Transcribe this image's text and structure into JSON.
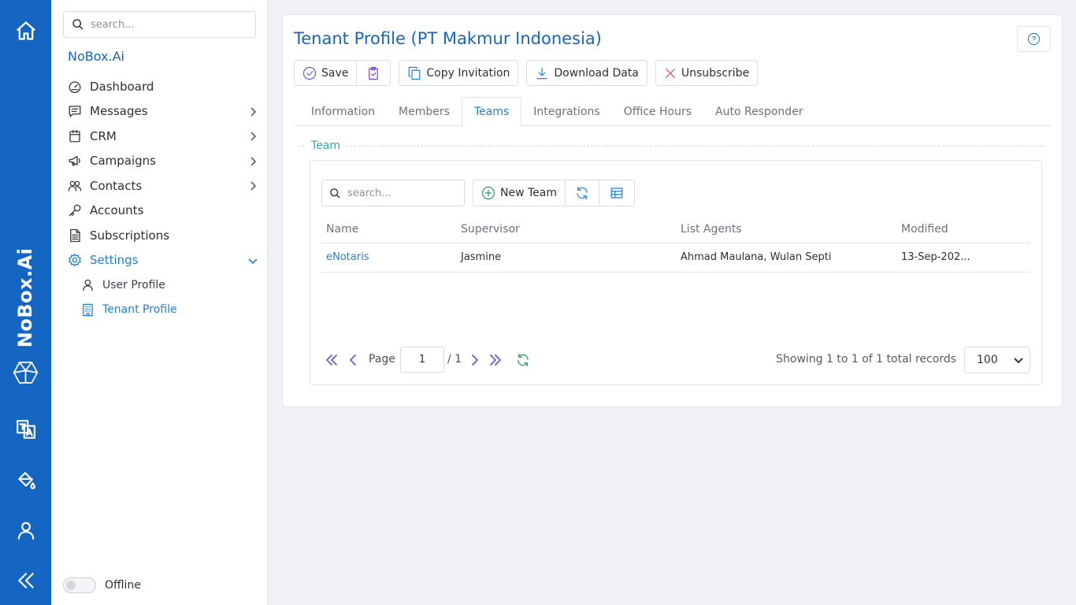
{
  "rail": {
    "brand": "NoBox.Ai",
    "icons": [
      "home-icon",
      "logo-cube-icon",
      "translate-icon",
      "paint-bucket-icon",
      "user-icon",
      "collapse-icon"
    ]
  },
  "sidebar": {
    "search_placeholder": "search...",
    "brand": "NoBox.Ai",
    "items": [
      {
        "label": "Dashboard",
        "icon": "gauge-icon"
      },
      {
        "label": "Messages",
        "icon": "message-icon"
      },
      {
        "label": "CRM",
        "icon": "calendar-icon"
      },
      {
        "label": "Campaigns",
        "icon": "megaphone-icon"
      },
      {
        "label": "Contacts",
        "icon": "users-icon"
      },
      {
        "label": "Accounts",
        "icon": "key-icon"
      },
      {
        "label": "Subscriptions",
        "icon": "document-icon"
      },
      {
        "label": "Settings",
        "icon": "gear-icon"
      }
    ],
    "sub_items": [
      {
        "label": "User Profile",
        "icon": "user-icon"
      },
      {
        "label": "Tenant Profile",
        "icon": "building-icon"
      }
    ],
    "offline_label": "Offline"
  },
  "page": {
    "title": "Tenant Profile (PT Makmur Indonesia)"
  },
  "toolbar": {
    "save": "Save",
    "copy_invitation": "Copy Invitation",
    "download_data": "Download Data",
    "unsubscribe": "Unsubscribe"
  },
  "tabs": [
    "Information",
    "Members",
    "Teams",
    "Integrations",
    "Office Hours",
    "Auto Responder"
  ],
  "active_tab": "Teams",
  "section": {
    "legend": "Team",
    "search_placeholder": "search...",
    "new_team": "New Team"
  },
  "table": {
    "columns": [
      "Name",
      "Supervisor",
      "List Agents",
      "Modified"
    ],
    "rows": [
      {
        "name": "eNotaris",
        "supervisor": "Jasmine",
        "agents": "Ahmad Maulana, Wulan Septi",
        "modified": "13-Sep-202..."
      }
    ]
  },
  "pager": {
    "page_label": "Page",
    "page_value": "1",
    "total_pages": "/ 1",
    "showing": "Showing 1 to 1 of 1 total records",
    "per_page": "100"
  },
  "colors": {
    "rail": "#1466c2",
    "accent": "#1e7fd8",
    "legend": "#3aa7a7"
  }
}
